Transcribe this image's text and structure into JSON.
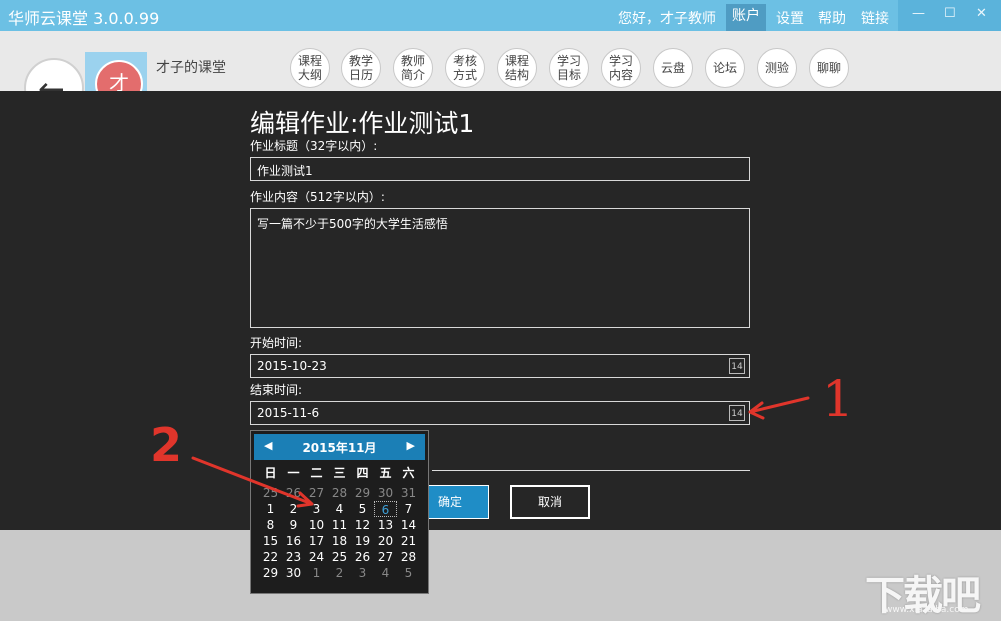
{
  "titlebar": {
    "app_title": "华师云课堂 3.0.0.99",
    "greeting": "您好，才子教师",
    "menu": [
      "账户",
      "设置",
      "帮助",
      "链接"
    ],
    "win_minimize": "—",
    "win_maximize": "☐",
    "win_close": "✕"
  },
  "header": {
    "back_icon": "←",
    "logo_text": "才",
    "course_name": "才子的课堂",
    "nav": [
      "课程大纲",
      "教学日历",
      "教师简介",
      "考核方式",
      "课程结构",
      "学习目标",
      "学习内容",
      "云盘",
      "论坛",
      "测验",
      "聊聊"
    ]
  },
  "form": {
    "title": "编辑作业:作业测试1",
    "title_label": "作业标题（32字以内）:",
    "title_value": "作业测试1",
    "content_label": "作业内容（512字以内）:",
    "content_value": "写一篇不少于500字的大学生活感悟",
    "start_label": "开始时间:",
    "start_value": "2015-10-23",
    "end_label": "结束时间:",
    "end_value": "2015-11-6",
    "calendar_icon": "14",
    "ok_label": "确定",
    "cancel_label": "取消"
  },
  "calendar": {
    "month": "2015年11月",
    "prev": "◀",
    "next": "▶",
    "weekdays": [
      "日",
      "一",
      "二",
      "三",
      "四",
      "五",
      "六"
    ],
    "weeks": [
      [
        "25",
        "26",
        "27",
        "28",
        "29",
        "30",
        "31"
      ],
      [
        "1",
        "2",
        "3",
        "4",
        "5",
        "6",
        "7"
      ],
      [
        "8",
        "9",
        "10",
        "11",
        "12",
        "13",
        "14"
      ],
      [
        "15",
        "16",
        "17",
        "18",
        "19",
        "20",
        "21"
      ],
      [
        "22",
        "23",
        "24",
        "25",
        "26",
        "27",
        "28"
      ],
      [
        "29",
        "30",
        "1",
        "2",
        "3",
        "4",
        "5"
      ]
    ],
    "selected": "6"
  },
  "annotations": {
    "label1": "1",
    "label2": "2"
  },
  "watermark": {
    "text": "下载吧",
    "url": "www.xiazaiba.com"
  },
  "colors": {
    "titlebar": "#6cc0e4",
    "accent": "#1f8dc6",
    "annotation": "#e0352b"
  }
}
